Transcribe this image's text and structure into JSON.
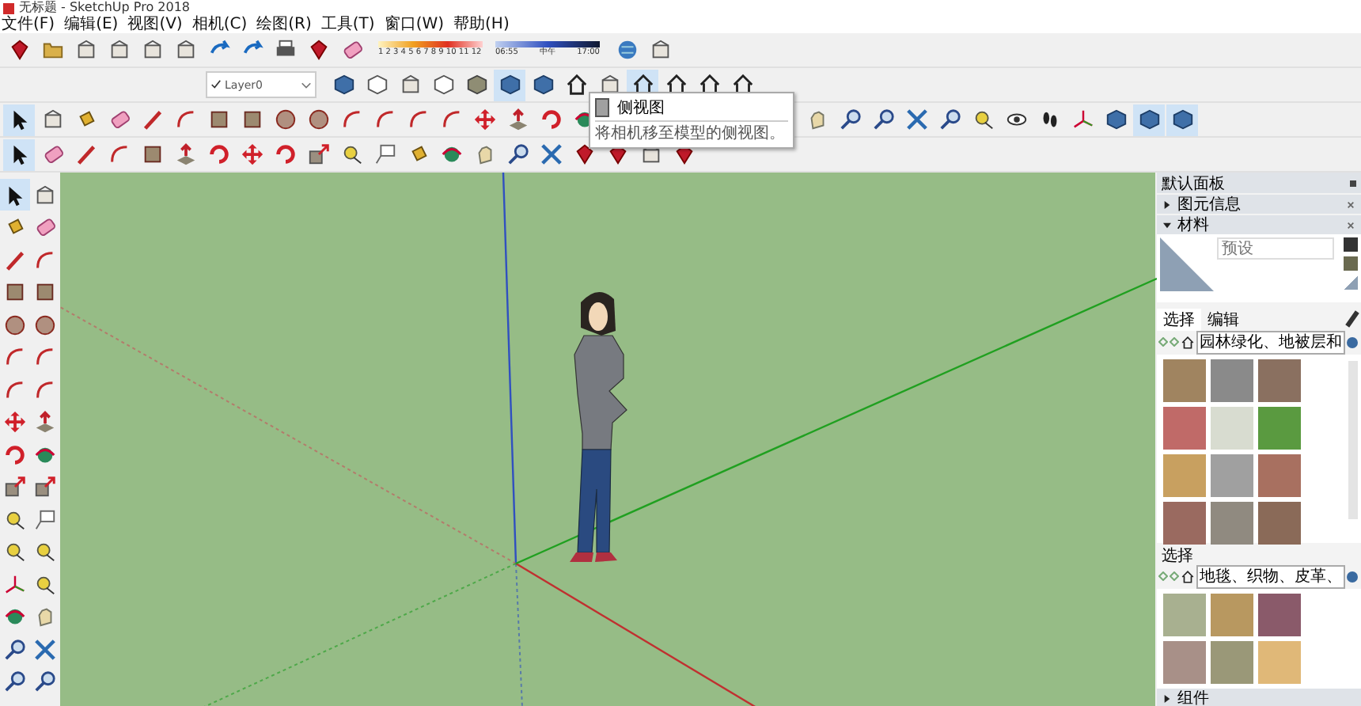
{
  "window": {
    "title": "无标题 - SketchUp Pro 2018"
  },
  "menu": [
    "文件(F)",
    "编辑(E)",
    "视图(V)",
    "相机(C)",
    "绘图(R)",
    "工具(T)",
    "窗口(W)",
    "帮助(H)"
  ],
  "shadow_settings": {
    "months": "1 2 3 4 5 6 7 8 9 10 11 12",
    "times": [
      "06:55",
      "中午",
      "17:00"
    ]
  },
  "layer_dropdown": {
    "value": "Layer0",
    "checked": true
  },
  "tooltip": {
    "title": "侧视图",
    "description": "将相机移至模型的侧视图。"
  },
  "tray": {
    "title": "默认面板",
    "sections": [
      {
        "label": "图元信息",
        "expanded": false
      },
      {
        "label": "材料",
        "expanded": true
      }
    ],
    "materials": {
      "name_placeholder": "预设",
      "tabs": [
        {
          "label": "选择",
          "selected": true
        },
        {
          "label": "编辑",
          "selected": false
        }
      ],
      "collection": "园林绿化、地被层和",
      "secondary_label": "选择",
      "secondary_collection": "地毯、织物、皮革、"
    },
    "bottom_section": {
      "label": "组件",
      "expanded": false
    }
  }
}
